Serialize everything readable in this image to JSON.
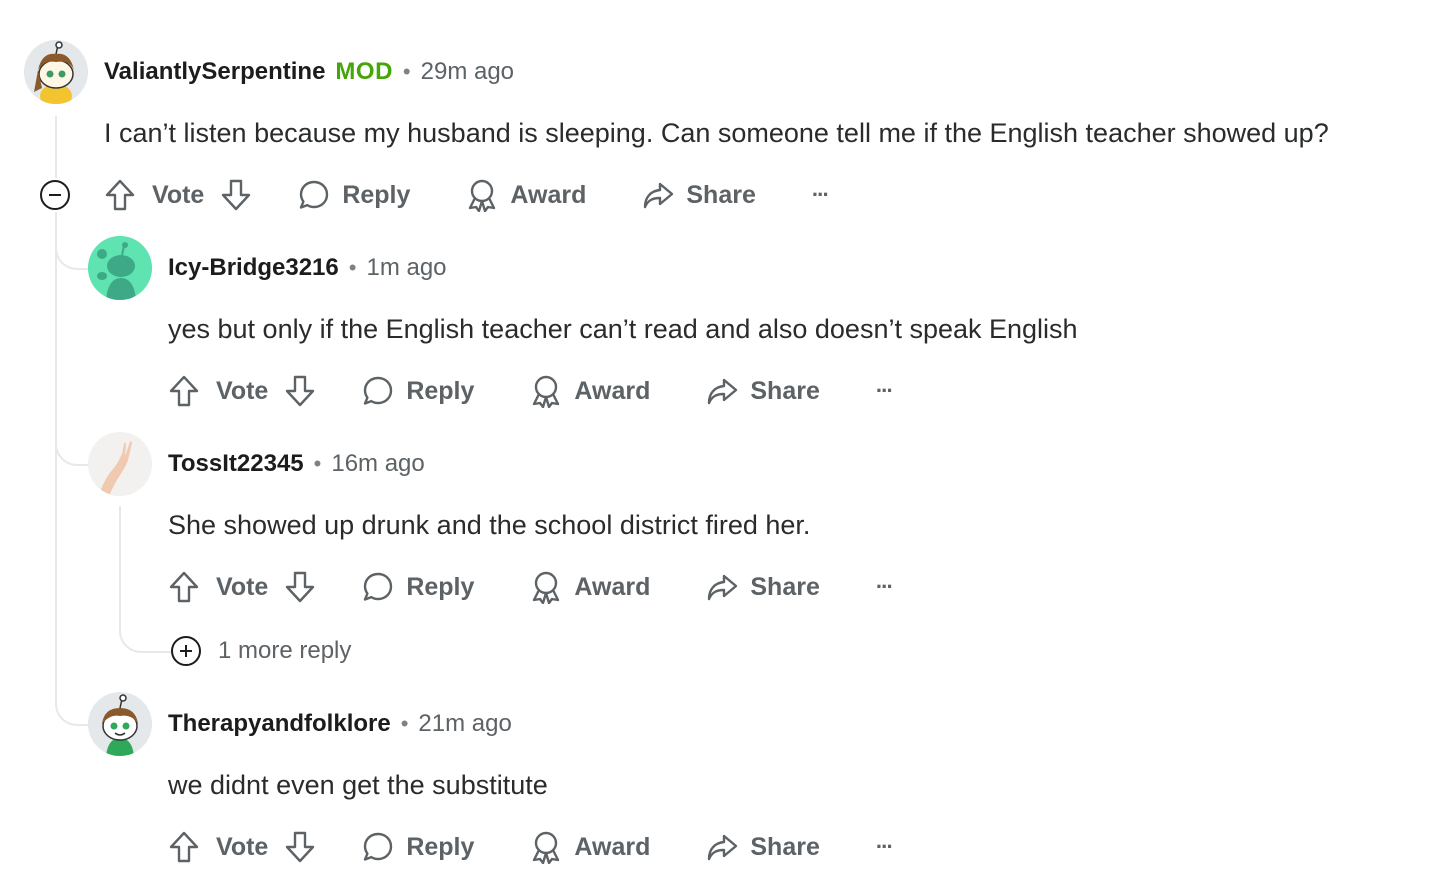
{
  "actions": {
    "vote": "Vote",
    "reply": "Reply",
    "award": "Award",
    "share": "Share",
    "more": "···"
  },
  "comments": [
    {
      "author": "ValiantlySerpentine",
      "badge": "MOD",
      "separator": "•",
      "time": "29m ago",
      "body": "I can’t listen because my husband is sleeping. Can someone tell me if the English teacher showed up?"
    },
    {
      "author": "Icy-Bridge3216",
      "separator": "•",
      "time": "1m ago",
      "body": "yes but only if the English teacher can’t read and also doesn’t speak English"
    },
    {
      "author": "TossIt22345",
      "separator": "•",
      "time": "16m ago",
      "body": "She showed up drunk and the school district fired her.",
      "more_replies": "1 more reply"
    },
    {
      "author": "Therapyandfolklore",
      "separator": "•",
      "time": "21m ago",
      "body": "we didnt even get the substitute"
    }
  ],
  "colors": {
    "mod_badge": "#46a508",
    "thread_line": "#e6e8ea",
    "meta_text": "#5c6265",
    "icy_avatar_bg": "#5fe3b1"
  }
}
